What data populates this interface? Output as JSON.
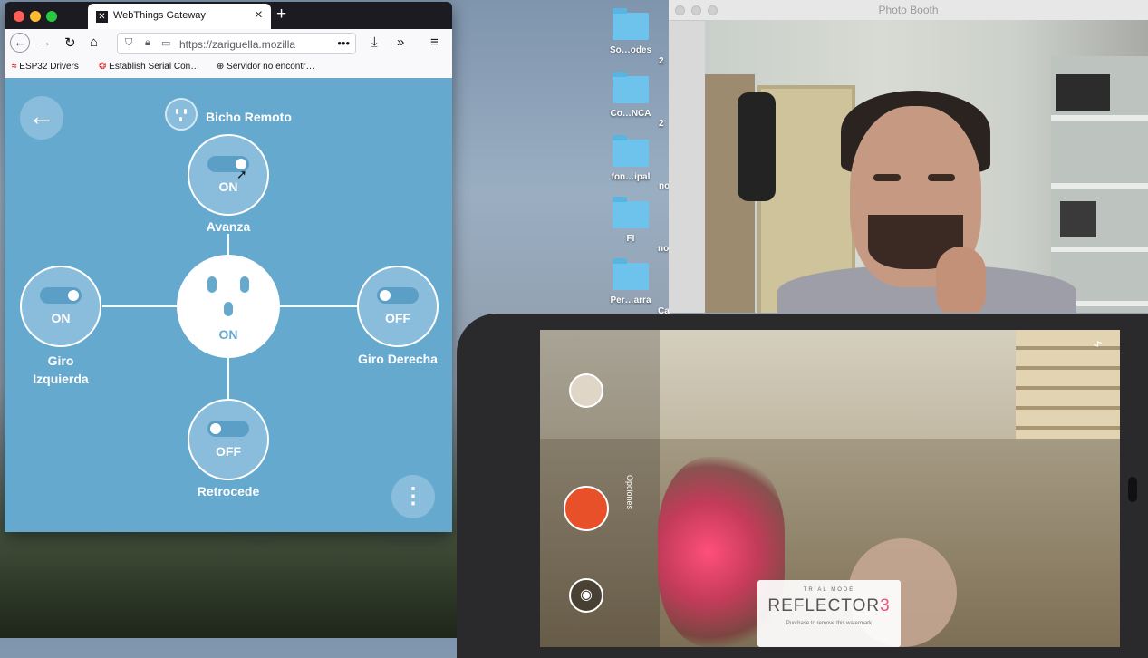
{
  "desktop": {
    "icons": [
      {
        "label": "So…odes",
        "icon": "folder-icon"
      },
      {
        "label": "Co…NCA",
        "icon": "folder-icon"
      },
      {
        "label": "fon…ipal",
        "icon": "folder-icon"
      },
      {
        "label": "FI",
        "icon": "folder-icon"
      },
      {
        "label": "Per…arra",
        "icon": "folder-icon"
      }
    ],
    "partial_labels": [
      "2",
      "2",
      "no",
      "no",
      "Ca"
    ]
  },
  "browser": {
    "tab_title": "WebThings Gateway",
    "new_tab": "+",
    "url": "https://zariguella.mozilla",
    "bookmarks": [
      "ESP32 Drivers",
      "Establish Serial Con…",
      "Servidor no encontr…"
    ],
    "colors": {
      "page_bg": "#65a9cf",
      "tab_bar": "#1c1b22"
    }
  },
  "thing": {
    "title": "Bicho Remoto",
    "center_state": "ON",
    "properties": [
      {
        "label": "Avanza",
        "state": "ON",
        "on": true
      },
      {
        "label": "Giro Izquierda",
        "state": "ON",
        "on": true
      },
      {
        "label": "Giro Derecha",
        "state": "OFF",
        "on": false
      },
      {
        "label": "Retrocede",
        "state": "OFF",
        "on": false
      }
    ],
    "back_glyph": "←",
    "menu_glyph": "⋮"
  },
  "photobooth": {
    "title": "Photo Booth"
  },
  "phone": {
    "options_label": "Opciones",
    "camera_glyph": "◉",
    "watermark": {
      "trial": "TRIAL MODE",
      "brand": "REFLECTOR",
      "version": "3",
      "note": "Purchase to remove this watermark"
    },
    "colors": {
      "record": "#e8502a"
    }
  }
}
